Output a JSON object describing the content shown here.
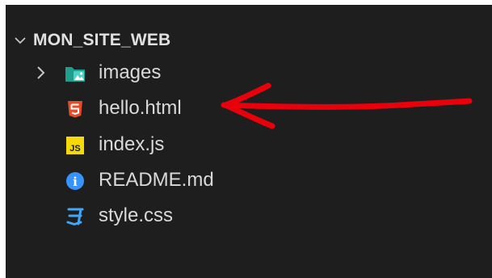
{
  "explorer": {
    "section_title": "MON_SITE_WEB",
    "items": [
      {
        "label": "images",
        "type": "folder",
        "icon": "folder-images-icon"
      },
      {
        "label": "hello.html",
        "type": "file",
        "icon": "html5-icon"
      },
      {
        "label": "index.js",
        "type": "file",
        "icon": "js-icon",
        "icon_text": "JS"
      },
      {
        "label": "README.md",
        "type": "file",
        "icon": "info-icon",
        "icon_text": "i"
      },
      {
        "label": "style.css",
        "type": "file",
        "icon": "css3-icon"
      }
    ]
  },
  "colors": {
    "panel_background": "#1e1e1e",
    "text": "#d9d9d9",
    "folder_teal": "#1e9e8c",
    "html_orange": "#e44d26",
    "js_yellow": "#f5d90a",
    "info_blue": "#3794ff",
    "css_blue": "#42a5f5",
    "annotation_red": "#e8000b"
  }
}
